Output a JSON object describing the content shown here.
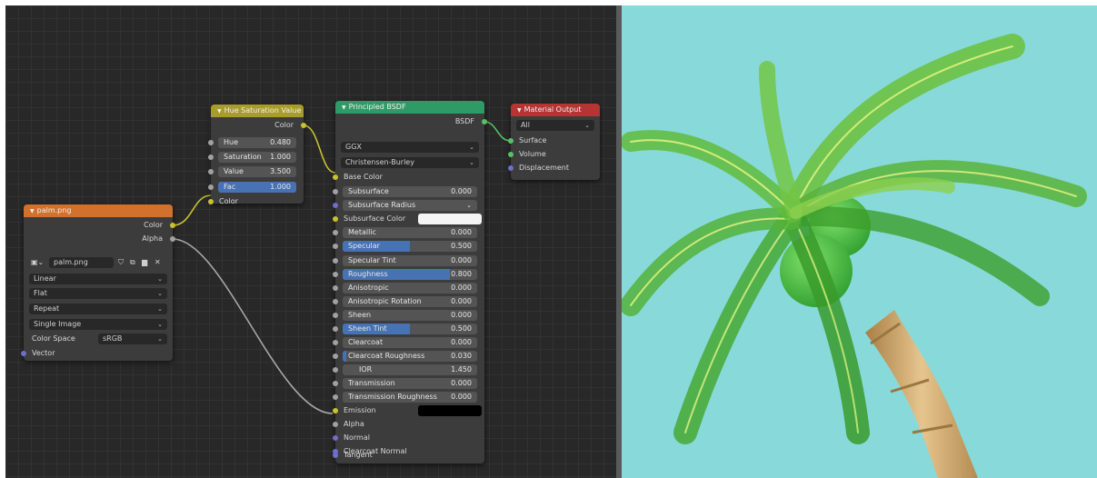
{
  "colors": {
    "socket_color": "#c8c131",
    "socket_float": "#a1a1a1",
    "socket_vector": "#6d6fc8",
    "socket_shader": "#58c063",
    "header_texture": "#d2712d",
    "header_color": "#a89d2b",
    "header_shader": "#2e9b67",
    "header_output": "#b53434",
    "slider_fill": "#4772b3",
    "viewport_background": "#88dada"
  },
  "nodes": {
    "image_texture": {
      "title": "palm.png",
      "outputs": [
        "Color",
        "Alpha"
      ],
      "image_name": "palm.png",
      "interpolation": "Linear",
      "projection": "Flat",
      "extension": "Repeat",
      "source": "Single Image",
      "color_space_label": "Color Space",
      "color_space_value": "sRGB",
      "input_vector": "Vector"
    },
    "hue_saturation": {
      "title": "Hue Saturation Value",
      "output": "Color",
      "fields": [
        {
          "label": "Hue",
          "value": "0.480"
        },
        {
          "label": "Saturation",
          "value": "1.000"
        },
        {
          "label": "Value",
          "value": "3.500"
        },
        {
          "label": "Fac",
          "value": "1.000",
          "fill": 1.0
        }
      ],
      "input_color": "Color"
    },
    "principled": {
      "title": "Principled BSDF",
      "output": "BSDF",
      "distribution": "GGX",
      "subsurface_method": "Christensen-Burley",
      "base_color_label": "Base Color",
      "subsurface": {
        "label": "Subsurface",
        "value": "0.000"
      },
      "subsurface_radius": "Subsurface Radius",
      "subsurface_color_label": "Subsurface Color",
      "subsurface_color": "#f4f4f4",
      "fields": [
        {
          "label": "Metallic",
          "value": "0.000",
          "fill": 0.0
        },
        {
          "label": "Specular",
          "value": "0.500",
          "fill": 0.5
        },
        {
          "label": "Specular Tint",
          "value": "0.000",
          "fill": 0.0
        },
        {
          "label": "Roughness",
          "value": "0.800",
          "fill": 0.8
        },
        {
          "label": "Anisotropic",
          "value": "0.000",
          "fill": 0.0
        },
        {
          "label": "Anisotropic Rotation",
          "value": "0.000",
          "fill": 0.0
        },
        {
          "label": "Sheen",
          "value": "0.000",
          "fill": 0.0
        },
        {
          "label": "Sheen Tint",
          "value": "0.500",
          "fill": 0.5
        },
        {
          "label": "Clearcoat",
          "value": "0.000",
          "fill": 0.0
        },
        {
          "label": "Clearcoat Roughness",
          "value": "0.030",
          "fill": 0.03
        }
      ],
      "ior": {
        "label": "IOR",
        "value": "1.450"
      },
      "transmission": {
        "label": "Transmission",
        "value": "0.000"
      },
      "transmission_roughness": {
        "label": "Transmission Roughness",
        "value": "0.000"
      },
      "emission_label": "Emission",
      "emission_color": "#000000",
      "inputs_after": [
        "Alpha",
        "Normal",
        "Clearcoat Normal",
        "Tangent"
      ]
    },
    "material_output": {
      "title": "Material Output",
      "target": "All",
      "inputs": [
        "Surface",
        "Volume",
        "Displacement"
      ]
    }
  }
}
